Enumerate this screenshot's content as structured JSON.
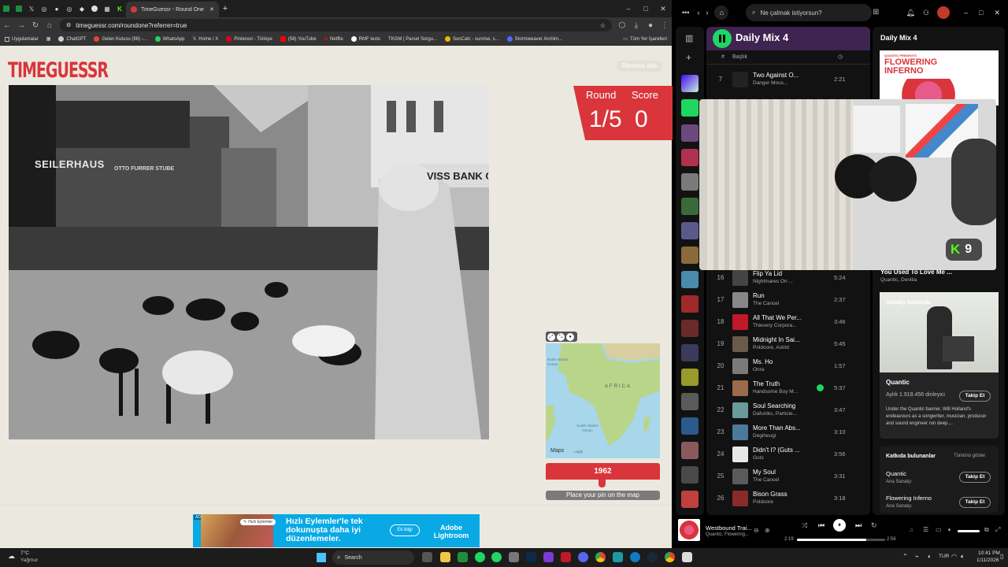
{
  "browser": {
    "tab_title": "TimeGuessr - Round One",
    "url": "timeguessr.com/roundone?referrer=true",
    "bookmarks": [
      "Uygulamalar",
      "ChatGPT",
      "Gelen Kutusu (98) -...",
      "WhatsApp",
      "Home / X",
      "Pinterest - Türkiye",
      "(58) YouTube",
      "Netflix",
      "RMF tests",
      "TKGM | Parsel Sorgu...",
      "SunCalc - sunrise, s...",
      "Stormweaver Archim...",
      "Tüm Yer İşaretleri"
    ],
    "new_tab_symbol": "+",
    "win_minimize": "–",
    "win_maximize": "□",
    "win_close": "✕"
  },
  "game": {
    "logo": "TIMEGUESSR",
    "remove_ads": "Remove ads",
    "round_label": "Round",
    "score_label": "Score",
    "round_value": "1/5",
    "score_value": "0",
    "year_value": "1962",
    "place_pin": "Place your pin on the map",
    "map": {
      "africa_label": "AFRICA",
      "north_ocean": "North Atlantic Ocean",
      "south_ocean": "South Atlantic Ocean",
      "maps_brand": "Maps",
      "legal": "Legal"
    },
    "photo_signs": [
      "SEILERHAUS",
      "OTTO FURRER STUBE",
      "VISS BANK C"
    ],
    "ad": {
      "badge": "AD",
      "quick_actions": "Hızlı Eylemler",
      "headline": "Hızlı Eylemler'le tek dokunuşta daha iyi düzenlemeler.",
      "cta": "Ek bilgi",
      "brand": "Adobe Lightroom"
    }
  },
  "spotify": {
    "search_placeholder": "Ne çalmak istiyorsun?",
    "playlist_title": "Daily Mix 4",
    "col_title": "Başlık",
    "tracks": [
      {
        "num": "7",
        "title": "Two Against O...",
        "artist": "Danger Mous...",
        "duration": "2:21"
      },
      {
        "num": "16",
        "title": "Flip Ya Lid",
        "artist": "Nightmares On ...",
        "duration": "5:24"
      },
      {
        "num": "17",
        "title": "Run",
        "artist": "The Cancel",
        "duration": "2:37"
      },
      {
        "num": "18",
        "title": "All That We Per...",
        "artist": "Thievery Corpora...",
        "duration": "3:46"
      },
      {
        "num": "19",
        "title": "Midnight In Sai...",
        "artist": "Poldoore, Astrid",
        "duration": "5:45"
      },
      {
        "num": "20",
        "title": "Ms. Ho",
        "artist": "Onra",
        "duration": "1:57"
      },
      {
        "num": "21",
        "title": "The Truth",
        "artist": "Handsome Boy M...",
        "duration": "5:37"
      },
      {
        "num": "22",
        "title": "Soul Searching",
        "artist": "Dafuniks, Particle...",
        "duration": "3:47"
      },
      {
        "num": "23",
        "title": "More Than Abs...",
        "artist": "Degiheugi",
        "duration": "3:10"
      },
      {
        "num": "24",
        "title": "Didn't I? (Guts ...",
        "artist": "Guts",
        "duration": "3:56"
      },
      {
        "num": "25",
        "title": "My Soul",
        "artist": "The Cancel",
        "duration": "3:31"
      },
      {
        "num": "26",
        "title": "Bison Grass",
        "artist": "Poldoore",
        "duration": "3:18"
      }
    ],
    "right_title": "Daily Mix 4",
    "cover_text": "FLOWERING INFERNO",
    "cover_small": "QUANTIC PRESENTS",
    "now_song_partial": "You Used To Love Me ...",
    "now_song_artists": "Quantic, Denitia",
    "about_label": "Sanatçı hakkında",
    "artist_name": "Quantic",
    "monthly": "Aylık 1.918.456 dinleyici",
    "follow": "Takip Et",
    "bio": "Under the Quantic banner, Will Holland's endeavours as a songwriter, musician, producer and sound engineer run deep....",
    "credits_title": "Katkıda bulunanlar",
    "credits_all": "Tümünü göster",
    "credits": [
      {
        "name": "Quantic",
        "role": "Ana Sanatçı"
      },
      {
        "name": "Flowering Inferno",
        "role": "Ana Sanatçı"
      }
    ],
    "webcam_badge": "9",
    "player": {
      "title": "Westbound Trai...",
      "artist": "Quantic, Flowering...",
      "elapsed": "2:19",
      "total": "2:56",
      "progress": 0.79
    }
  },
  "taskbar": {
    "weather_temp": "7°C",
    "weather_desc": "Yağmur",
    "search": "Search",
    "lang": "TUR",
    "time": "10:41 PM",
    "date": "1/11/2026"
  }
}
